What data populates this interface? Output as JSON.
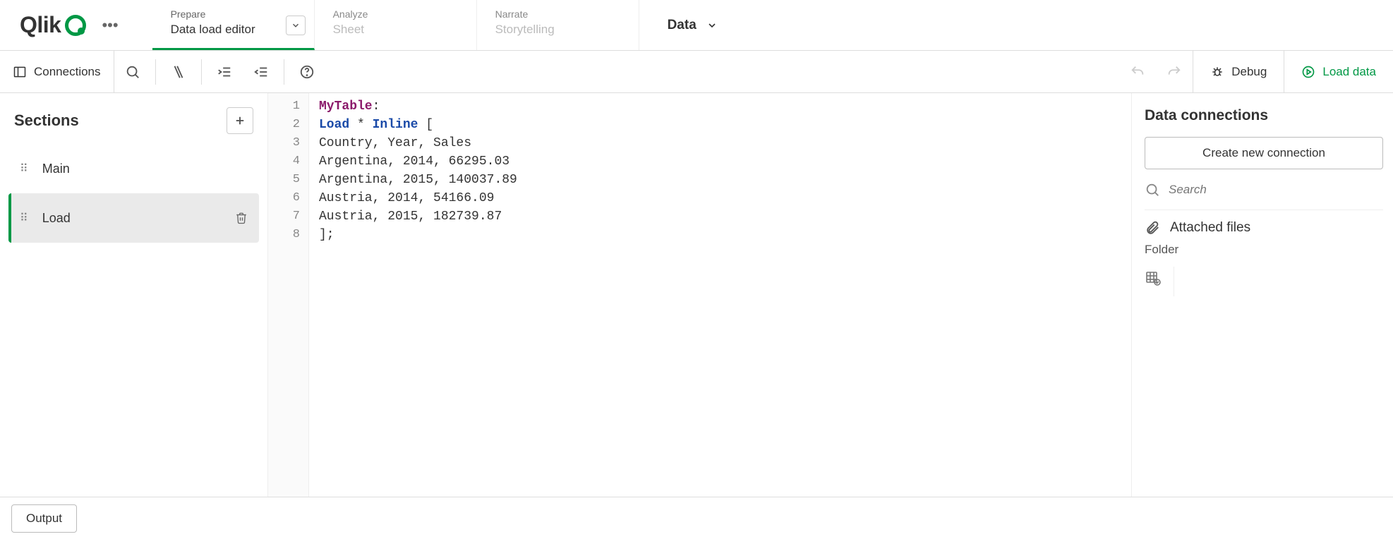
{
  "header": {
    "logo_text": "Qlik",
    "tabs": [
      {
        "top": "Prepare",
        "bottom": "Data load editor",
        "active": true,
        "has_chevron": true
      },
      {
        "top": "Analyze",
        "bottom": "Sheet",
        "active": false,
        "has_chevron": false
      },
      {
        "top": "Narrate",
        "bottom": "Storytelling",
        "active": false,
        "has_chevron": false
      }
    ],
    "app_name": "Data"
  },
  "toolbar": {
    "connections_label": "Connections",
    "debug_label": "Debug",
    "load_data_label": "Load data"
  },
  "sections": {
    "title": "Sections",
    "items": [
      {
        "label": "Main",
        "selected": false
      },
      {
        "label": "Load",
        "selected": true
      }
    ]
  },
  "editor": {
    "lines": [
      {
        "n": "1",
        "segments": [
          {
            "t": "MyTable",
            "c": "kw-table"
          },
          {
            "t": ":",
            "c": ""
          }
        ]
      },
      {
        "n": "2",
        "segments": [
          {
            "t": "Load",
            "c": "kw-load"
          },
          {
            "t": " * ",
            "c": ""
          },
          {
            "t": "Inline",
            "c": "kw-load"
          },
          {
            "t": " [",
            "c": ""
          }
        ]
      },
      {
        "n": "3",
        "segments": [
          {
            "t": "Country, Year, Sales",
            "c": ""
          }
        ]
      },
      {
        "n": "4",
        "segments": [
          {
            "t": "Argentina, 2014, 66295.03",
            "c": ""
          }
        ]
      },
      {
        "n": "5",
        "segments": [
          {
            "t": "Argentina, 2015, 140037.89",
            "c": ""
          }
        ]
      },
      {
        "n": "6",
        "segments": [
          {
            "t": "Austria, 2014, 54166.09",
            "c": ""
          }
        ]
      },
      {
        "n": "7",
        "segments": [
          {
            "t": "Austria, 2015, 182739.87",
            "c": ""
          }
        ]
      },
      {
        "n": "8",
        "segments": [
          {
            "t": "];",
            "c": ""
          }
        ]
      }
    ]
  },
  "right_panel": {
    "title": "Data connections",
    "create_btn": "Create new connection",
    "search_placeholder": "Search",
    "attached_label": "Attached files",
    "folder_label": "Folder"
  },
  "footer": {
    "output_label": "Output"
  }
}
